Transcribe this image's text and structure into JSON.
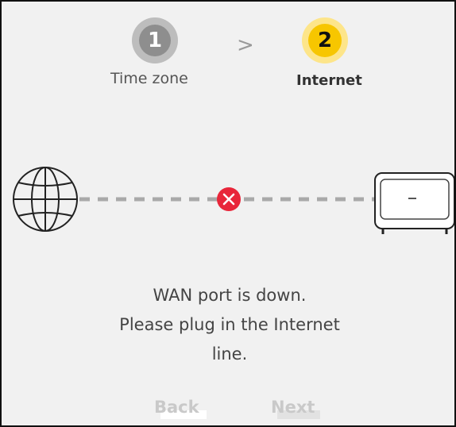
{
  "wizard": {
    "steps": [
      {
        "number": "1",
        "label": "Time zone",
        "state": "completed"
      },
      {
        "number": "2",
        "label": "Internet",
        "state": "active"
      }
    ],
    "separator": ">"
  },
  "status": {
    "connection": "down",
    "icons": [
      "globe-icon",
      "error-x-icon",
      "router-icon"
    ],
    "message_lines": [
      "WAN port is down.",
      "Please plug in the Internet",
      "line."
    ]
  },
  "buttons": {
    "back_label": "Back",
    "next_label": "Next"
  },
  "colors": {
    "active_step": "#f7c600",
    "inactive_step": "#8e8e8e",
    "error": "#e8263a",
    "disabled_text": "#c9c9c9"
  }
}
